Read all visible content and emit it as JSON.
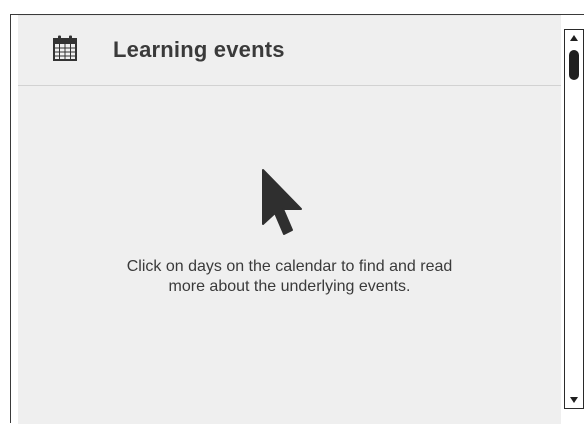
{
  "panel": {
    "title": "Learning events",
    "icon": "calendar-icon",
    "message_line1": "Click on days on the calendar to find and read",
    "message_line2": "more about the underlying events.",
    "cursor_icon": "mouse-pointer-icon"
  },
  "scrollbar": {
    "up_icon": "scroll-up-arrow-icon",
    "down_icon": "scroll-down-arrow-icon",
    "position": 0
  },
  "colors": {
    "panel_background": "#efefef",
    "text": "#3a3a3a",
    "divider": "#d2d2d2",
    "cursor": "#2f2f2f"
  }
}
